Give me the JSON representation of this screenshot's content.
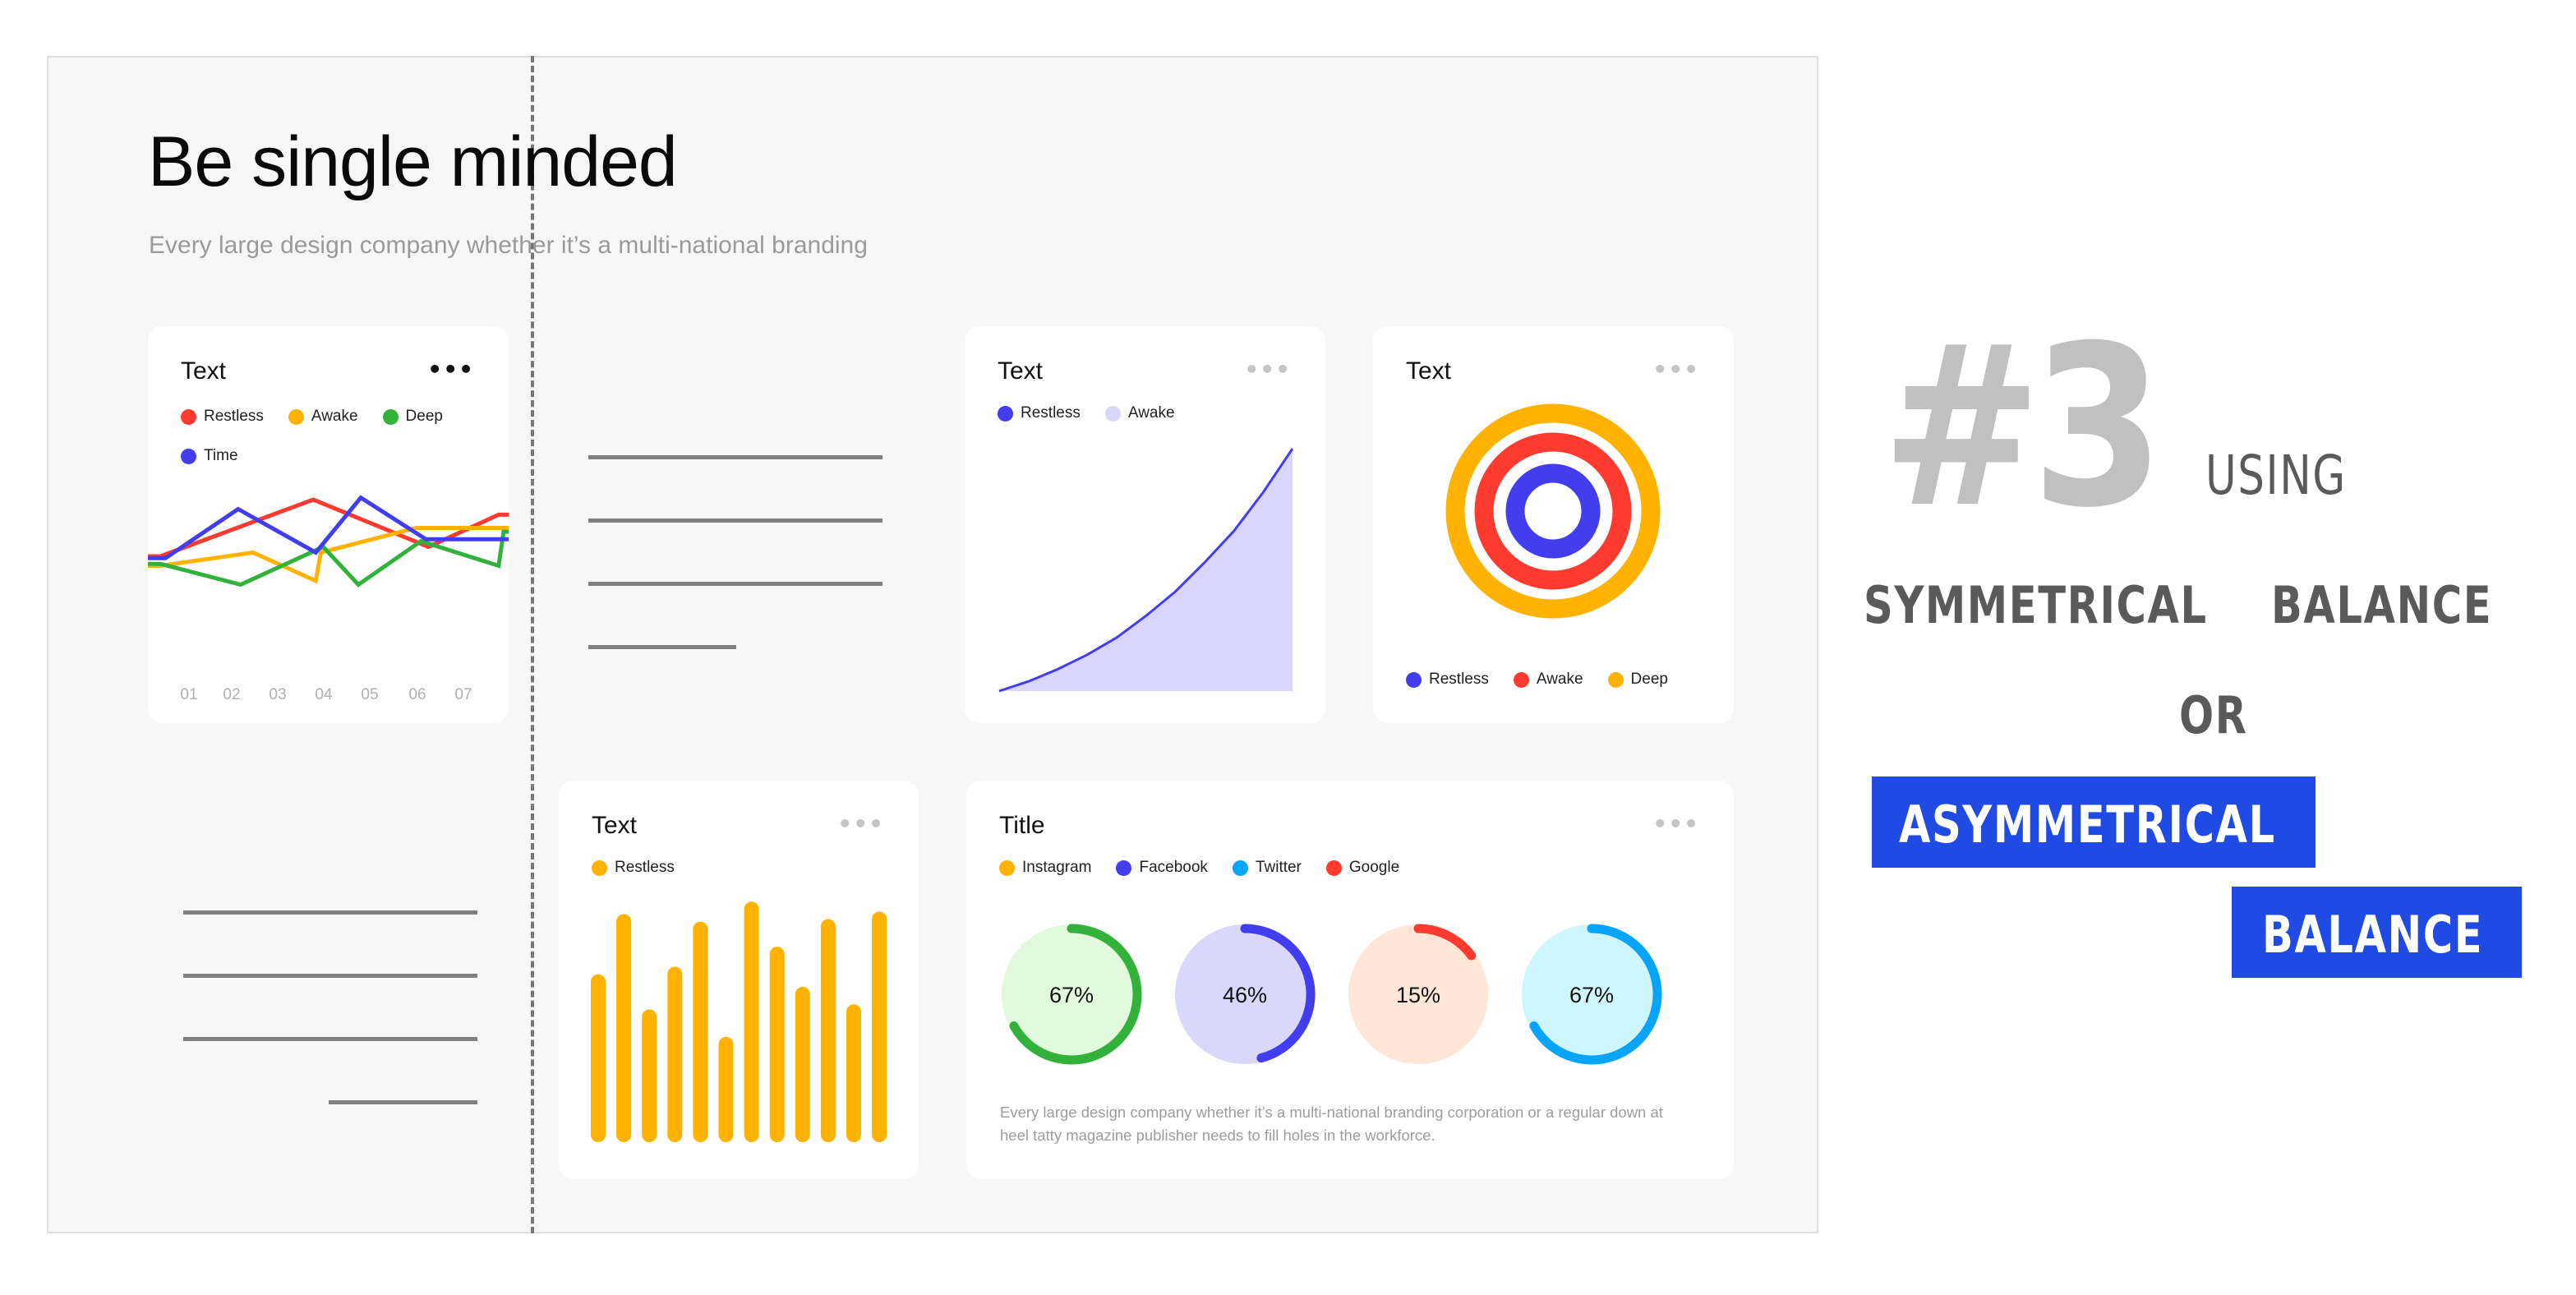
{
  "slide": {
    "headline": "Be single minded",
    "subtitle": "Every large design company whether it’s a multi-national branding"
  },
  "right_text": {
    "number": "#3",
    "using": "USING",
    "symmetrical": "SYMMETRICAL",
    "balance_1": "BALANCE",
    "or": "OR",
    "asymmetrical": "ASYMMETRICAL",
    "balance_2": "BALANCE",
    "highlight_color": "#1f4ae3",
    "text_color": "#5a5a5a",
    "number_color": "#c0c0c0"
  },
  "colors": {
    "red": "#ff3b2f",
    "yellow": "#ffb300",
    "green": "#33b23b",
    "blue": "#423ef0",
    "lavender": "#d8d6fc",
    "sky": "#06a4fa"
  },
  "cards": {
    "line_card": {
      "title": "Text",
      "more": "•••"
    },
    "area_card": {
      "title": "Text",
      "more": "•••"
    },
    "rings_card": {
      "title": "Text",
      "more": "•••"
    },
    "bar_card": {
      "title": "Text",
      "more": "•••"
    },
    "progress_card": {
      "title": "Title",
      "more": "•••",
      "description": "Every large design company whether it’s a multi-national branding corporation or a regular down at heel tatty magazine publisher needs to fill holes in the workforce."
    }
  },
  "chart_data": [
    {
      "id": "line",
      "type": "line",
      "title": "Text",
      "categories": [
        "01",
        "02",
        "03",
        "04",
        "05",
        "06",
        "07"
      ],
      "x": [
        0,
        0.25,
        1.5,
        2.5,
        3.0,
        4.0,
        5.0,
        6.0,
        6.75,
        7.0
      ],
      "ylim": [
        0,
        100
      ],
      "legend": "top-left",
      "series": [
        {
          "name": "Restless",
          "color": "#ff3b2f",
          "points": [
            [
              0,
              50
            ],
            [
              0.25,
              50
            ],
            [
              3.3,
              80
            ],
            [
              5.6,
              55
            ],
            [
              7.0,
              72
            ],
            [
              7.2,
              72
            ]
          ]
        },
        {
          "name": "Awake",
          "color": "#ffb300",
          "points": [
            [
              0,
              45
            ],
            [
              0.25,
              45
            ],
            [
              2.1,
              52
            ],
            [
              3.35,
              37
            ],
            [
              3.45,
              52
            ],
            [
              5.35,
              65
            ],
            [
              7.2,
              65
            ]
          ]
        },
        {
          "name": "Deep",
          "color": "#33b23b",
          "points": [
            [
              0,
              46
            ],
            [
              0.25,
              46
            ],
            [
              1.85,
              35
            ],
            [
              3.5,
              55
            ],
            [
              4.2,
              35
            ],
            [
              5.45,
              58
            ],
            [
              7.0,
              45
            ],
            [
              7.1,
              63
            ],
            [
              7.2,
              63
            ]
          ]
        },
        {
          "name": "Time",
          "color": "#423ef0",
          "points": [
            [
              0,
              49
            ],
            [
              0.35,
              49
            ],
            [
              1.8,
              75
            ],
            [
              3.35,
              52
            ],
            [
              4.25,
              81
            ],
            [
              5.55,
              59
            ],
            [
              7.2,
              59
            ]
          ]
        }
      ]
    },
    {
      "id": "area",
      "type": "area",
      "title": "Text",
      "legend": [
        "Restless",
        "Awake"
      ],
      "legend_colors": [
        "#423ef0",
        "#d8d6fc"
      ],
      "x": [
        0,
        0.1,
        0.2,
        0.3,
        0.4,
        0.5,
        0.6,
        0.7,
        0.8,
        0.9,
        1.0
      ],
      "values": [
        0,
        4,
        9,
        15,
        22,
        31,
        41,
        53,
        66,
        82,
        100
      ],
      "ylim": [
        0,
        100
      ]
    },
    {
      "id": "rings",
      "type": "pie",
      "title": "Text",
      "series": [
        {
          "name": "Restless",
          "color": "#423ef0"
        },
        {
          "name": "Awake",
          "color": "#ff3b2f"
        },
        {
          "name": "Deep",
          "color": "#ffb300"
        }
      ],
      "legend": "bottom"
    },
    {
      "id": "bars",
      "type": "bar",
      "title": "Text",
      "series": [
        {
          "name": "Restless",
          "color": "#ffb300",
          "values": [
            67,
            91,
            53,
            70,
            88,
            42,
            96,
            78,
            62,
            89,
            55,
            92
          ]
        }
      ],
      "ylim": [
        0,
        100
      ]
    },
    {
      "id": "progress",
      "type": "pie",
      "title": "Title",
      "legend": [
        "Instagram",
        "Facebook",
        "Twitter",
        "Google"
      ],
      "legend_colors": [
        "#ffb300",
        "#423ef0",
        "#06a4fa",
        "#ff3b2f"
      ],
      "rings": [
        {
          "label": "67%",
          "value": 67,
          "color": "#33b23b",
          "bg": "#e2f9dd"
        },
        {
          "label": "46%",
          "value": 46,
          "color": "#423ef0",
          "bg": "#d9d7fc"
        },
        {
          "label": "15%",
          "value": 15,
          "color": "#ff3b2f",
          "bg": "#ffe6d6"
        },
        {
          "label": "67%",
          "value": 67,
          "color": "#06a4fa",
          "bg": "#cdf6fd"
        }
      ]
    }
  ]
}
